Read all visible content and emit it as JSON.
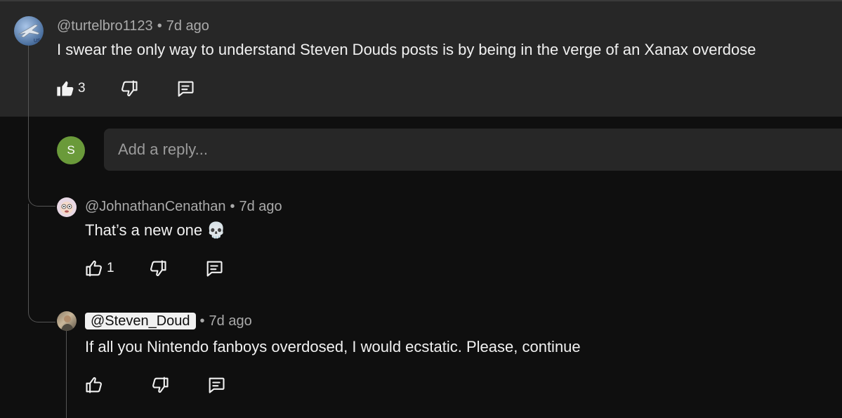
{
  "comments": [
    {
      "handle": "@turtelbro1123",
      "time": "7d ago",
      "text": "I swear the only way to understand Steven Douds posts is by being in the verge of an Xanax overdose",
      "likes": "3",
      "avatar_icon": "jet-avatar"
    },
    {
      "handle": "@JohnathanCenathan",
      "time": "7d ago",
      "text": "That’s a new one 💀",
      "likes": "1",
      "avatar_icon": "cartoon-face-avatar"
    },
    {
      "handle": "@Steven_Doud",
      "time": "7d ago",
      "text": "If all you Nintendo fanboys overdosed, I would ecstatic. Please, continue",
      "likes": "",
      "avatar_icon": "photo-avatar"
    }
  ],
  "reply": {
    "avatar_letter": "S",
    "placeholder": "Add a reply..."
  },
  "colors": {
    "background": "#0f0f0f",
    "panel": "#272727",
    "text": "#f1f1f1",
    "muted": "#aaaaaa",
    "avatar_green": "#6a9a3a"
  }
}
